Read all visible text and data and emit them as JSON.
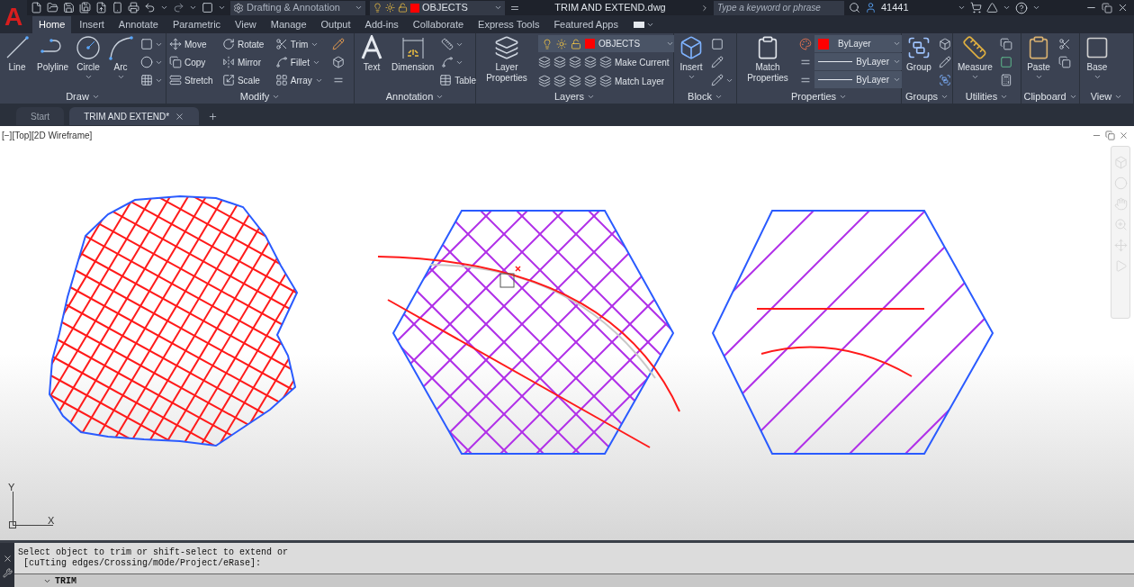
{
  "app_logo": "A",
  "quick_access": {
    "workspace": "Drafting & Annotation",
    "layer": "OBJECTS"
  },
  "title": "TRIM AND EXTEND.dwg",
  "search": {
    "placeholder": "Type a keyword or phrase"
  },
  "user": "41441",
  "ribbon_tabs": [
    {
      "label": "Home",
      "selected": true
    },
    {
      "label": "Insert",
      "selected": false
    },
    {
      "label": "Annotate",
      "selected": false
    },
    {
      "label": "Parametric",
      "selected": false
    },
    {
      "label": "View",
      "selected": false
    },
    {
      "label": "Manage",
      "selected": false
    },
    {
      "label": "Output",
      "selected": false
    },
    {
      "label": "Add-ins",
      "selected": false
    },
    {
      "label": "Collaborate",
      "selected": false
    },
    {
      "label": "Express Tools",
      "selected": false
    },
    {
      "label": "Featured Apps",
      "selected": false
    }
  ],
  "panels": [
    {
      "title": "Draw",
      "large": [
        "Line",
        "Polyline",
        "Circle",
        "Arc"
      ]
    },
    {
      "title": "Modify",
      "small": [
        "Move",
        "Rotate",
        "Trim",
        "Copy",
        "Mirror",
        "Fillet",
        "Stretch",
        "Scale",
        "Array"
      ]
    },
    {
      "title": "Annotation",
      "large": [
        "Text",
        "Dimension"
      ],
      "small": [
        "Table"
      ]
    },
    {
      "title": "Layers",
      "large": [
        "Layer Properties"
      ],
      "layer": "OBJECTS",
      "small": [
        "Make Current",
        "Match Layer"
      ]
    },
    {
      "title": "Block",
      "large": [
        "Insert"
      ]
    },
    {
      "title": "Properties",
      "large": [
        "Match Properties"
      ],
      "dropdowns": [
        "ByLayer",
        "ByLayer",
        "ByLayer"
      ]
    },
    {
      "title": "Groups",
      "large": [
        "Group"
      ]
    },
    {
      "title": "Utilities",
      "large": [
        "Measure"
      ]
    },
    {
      "title": "Clipboard",
      "large": [
        "Paste"
      ]
    },
    {
      "title": "View",
      "large": [
        "Base"
      ]
    }
  ],
  "documents": [
    {
      "label": "Start",
      "selected": false
    },
    {
      "label": "TRIM AND EXTEND*",
      "selected": true
    }
  ],
  "viewport_label": "[−][Top][2D Wireframe]",
  "ucs": {
    "x": "X",
    "y": "Y"
  },
  "command_history": [
    "Select object to trim or shift-select to extend or",
    "[cuTting edges/Crossing/mOde/Project/eRase]:"
  ],
  "command_prompt": "TRIM"
}
